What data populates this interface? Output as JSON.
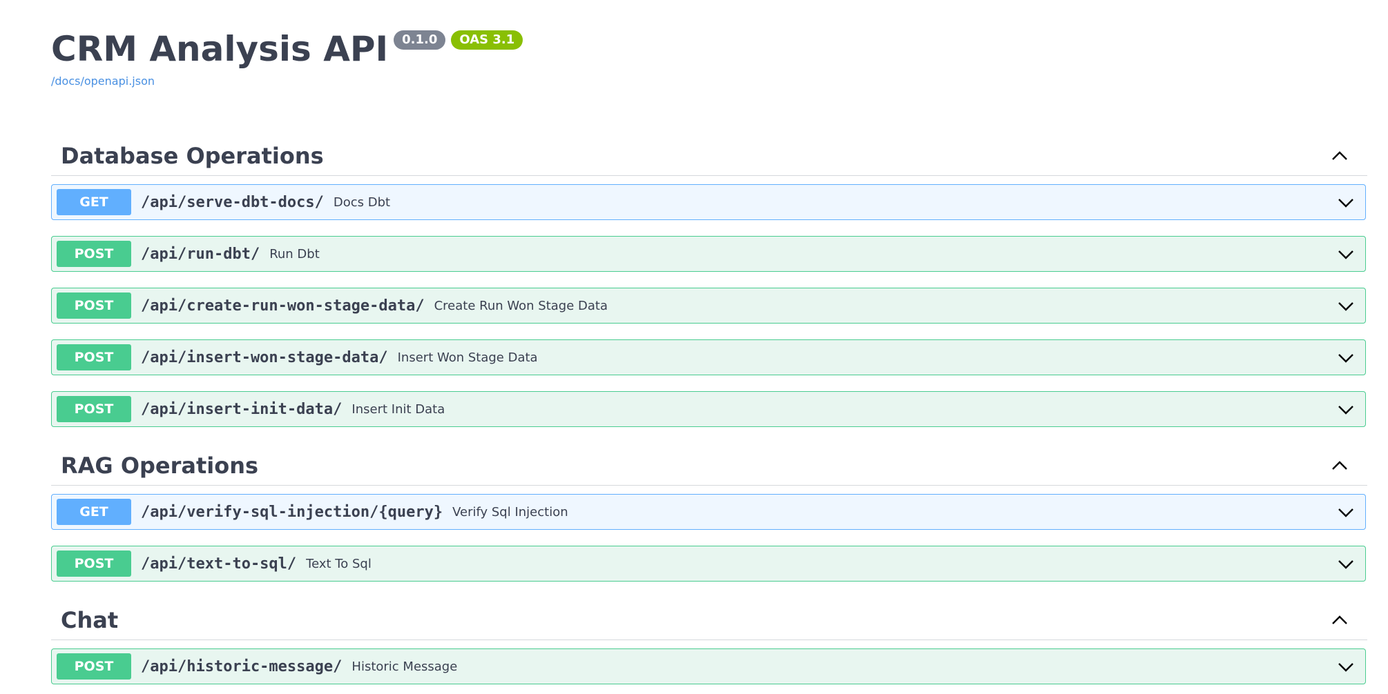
{
  "info": {
    "title": "CRM Analysis API",
    "version_badge": "0.1.0",
    "oas_badge": "OAS 3.1",
    "spec_link": "/docs/openapi.json"
  },
  "tags": [
    {
      "name": "Database Operations",
      "operations": [
        {
          "method": "GET",
          "path": "/api/serve-dbt-docs/",
          "summary": "Docs Dbt"
        },
        {
          "method": "POST",
          "path": "/api/run-dbt/",
          "summary": "Run Dbt"
        },
        {
          "method": "POST",
          "path": "/api/create-run-won-stage-data/",
          "summary": "Create Run Won Stage Data"
        },
        {
          "method": "POST",
          "path": "/api/insert-won-stage-data/",
          "summary": "Insert Won Stage Data"
        },
        {
          "method": "POST",
          "path": "/api/insert-init-data/",
          "summary": "Insert Init Data"
        }
      ]
    },
    {
      "name": "RAG Operations",
      "operations": [
        {
          "method": "GET",
          "path": "/api/verify-sql-injection/{query}",
          "summary": "Verify Sql Injection"
        },
        {
          "method": "POST",
          "path": "/api/text-to-sql/",
          "summary": "Text To Sql"
        }
      ]
    },
    {
      "name": "Chat",
      "operations": [
        {
          "method": "POST",
          "path": "/api/historic-message/",
          "summary": "Historic Message"
        }
      ]
    }
  ],
  "icons": {
    "collapse": "chevron-up-icon",
    "expand": "chevron-down-icon"
  },
  "colors": {
    "get": "#61affe",
    "post": "#49cc90",
    "version_badge": "#7d8492",
    "oas_badge": "#89bf04",
    "link": "#4990e2"
  }
}
